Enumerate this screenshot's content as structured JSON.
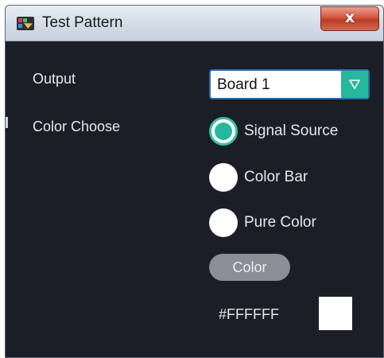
{
  "window": {
    "title": "Test Pattern",
    "close_label": "x",
    "icon": "app-logo-icon"
  },
  "output": {
    "label": "Output",
    "selected": "Board 1",
    "dropdown_icon": "chevron-down-icon"
  },
  "color_choose": {
    "label": "Color Choose",
    "options": [
      {
        "label": "Signal Source",
        "selected": true
      },
      {
        "label": "Color Bar",
        "selected": false
      },
      {
        "label": "Pure Color",
        "selected": false
      }
    ]
  },
  "color": {
    "button_label": "Color",
    "hex": "#FFFFFF",
    "swatch_color": "#FFFFFF"
  },
  "colors": {
    "background": "#1b1e27",
    "accent": "#26b89c",
    "button_gray": "#8a8e96",
    "close_red": "#c94530"
  }
}
